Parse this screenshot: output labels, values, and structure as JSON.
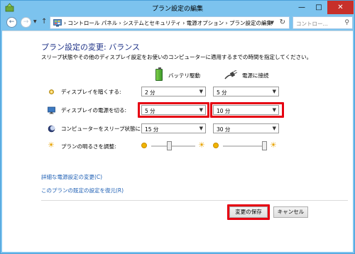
{
  "window": {
    "title": "プラン設定の編集"
  },
  "navbar": {
    "breadcrumb": [
      "コントロール パネル",
      "システムとセキュリティ",
      "電源オプション",
      "プラン設定の編集"
    ],
    "separator": "›",
    "search_placeholder": "コントロー..."
  },
  "page": {
    "heading": "プラン設定の変更: バランス",
    "description": "スリープ状態やその他のディスプレイ設定をお使いのコンピューターに適用するまでの時間を指定してください。",
    "columns": {
      "battery": "バッテリ駆動",
      "plugged": "電源に接続"
    }
  },
  "settings": [
    {
      "label": "ディスプレイを暗くする:",
      "battery": "2 分",
      "plugged": "5 分",
      "icon": "dim-display-icon"
    },
    {
      "label": "ディスプレイの電源を切る:",
      "battery": "5 分",
      "plugged": "10 分",
      "icon": "monitor-icon"
    },
    {
      "label": "コンピューターをスリープ状態にする:",
      "battery": "15 分",
      "plugged": "30 分",
      "icon": "moon-icon"
    }
  ],
  "brightness": {
    "label": "プランの明るさを調整:",
    "battery_level": 0.4,
    "plugged_level": 1.0
  },
  "links": {
    "advanced": "詳細な電源設定の変更(C)",
    "restore": "このプランの既定の設定を復元(R)"
  },
  "buttons": {
    "save": "変更の保存",
    "cancel": "キャンセル"
  },
  "colors": {
    "highlight": "#e60012",
    "heading": "#1e3287",
    "link": "#1e5fb4",
    "frame": "#7cc3ee"
  }
}
